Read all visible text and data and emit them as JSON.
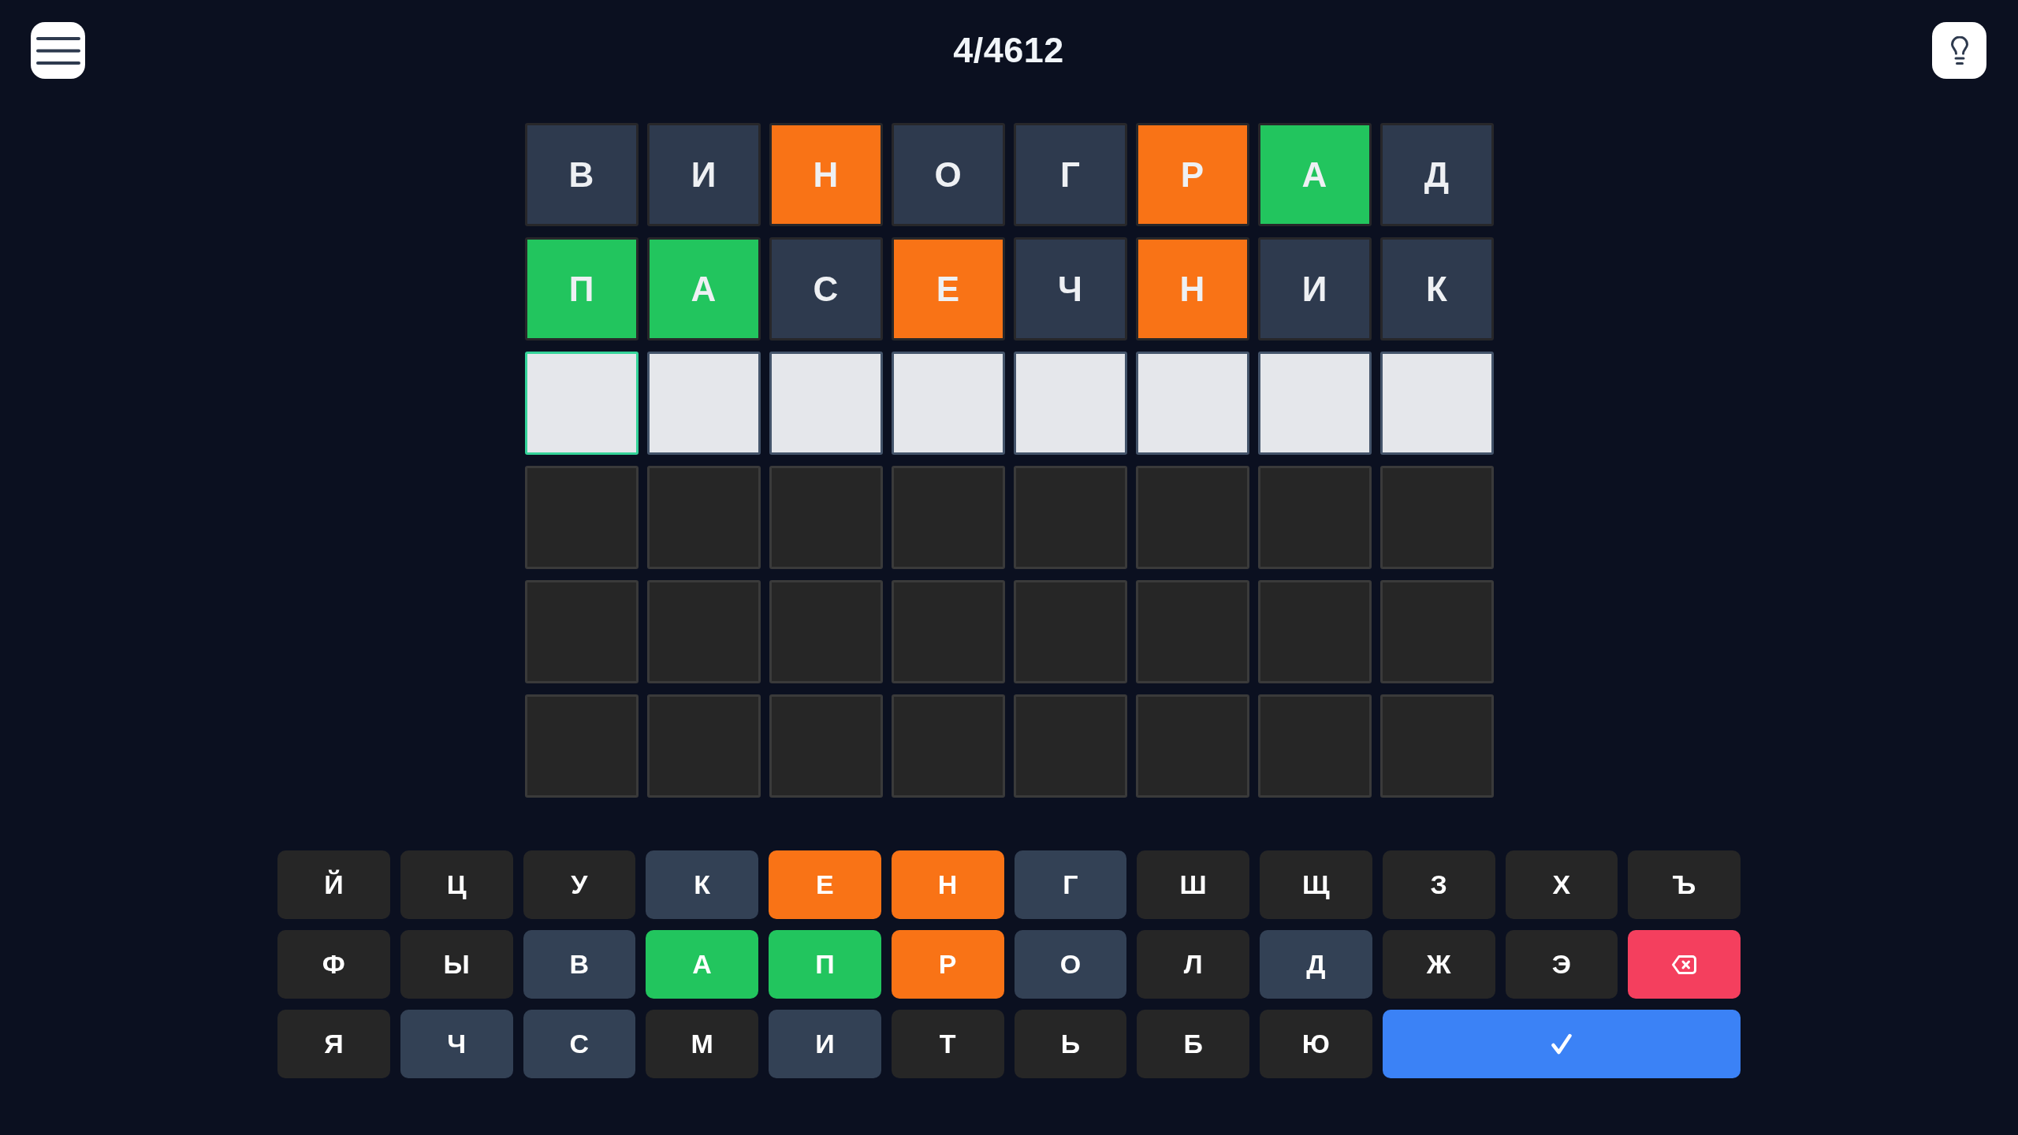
{
  "header": {
    "title": "4/4612"
  },
  "board": {
    "rows": [
      {
        "tiles": [
          {
            "kind": "letter",
            "letter": "В",
            "color": "#2e3a4e"
          },
          {
            "kind": "letter",
            "letter": "И",
            "color": "#2e3a4e"
          },
          {
            "kind": "letter",
            "letter": "Н",
            "color": "#f97316"
          },
          {
            "kind": "letter",
            "letter": "О",
            "color": "#2e3a4e"
          },
          {
            "kind": "letter",
            "letter": "Г",
            "color": "#2e3a4e"
          },
          {
            "kind": "letter",
            "letter": "Р",
            "color": "#f97316"
          },
          {
            "kind": "letter",
            "letter": "А",
            "color": "#22c55e"
          },
          {
            "kind": "letter",
            "letter": "Д",
            "color": "#2e3a4e"
          }
        ]
      },
      {
        "tiles": [
          {
            "kind": "letter",
            "letter": "П",
            "color": "#22c55e"
          },
          {
            "kind": "letter",
            "letter": "А",
            "color": "#22c55e"
          },
          {
            "kind": "letter",
            "letter": "С",
            "color": "#2e3a4e"
          },
          {
            "kind": "letter",
            "letter": "Е",
            "color": "#f97316"
          },
          {
            "kind": "letter",
            "letter": "Ч",
            "color": "#2e3a4e"
          },
          {
            "kind": "letter",
            "letter": "Н",
            "color": "#f97316"
          },
          {
            "kind": "letter",
            "letter": "И",
            "color": "#2e3a4e"
          },
          {
            "kind": "letter",
            "letter": "К",
            "color": "#2e3a4e"
          }
        ]
      },
      {
        "tiles": [
          {
            "kind": "input",
            "selected": true
          },
          {
            "kind": "input",
            "selected": false
          },
          {
            "kind": "input",
            "selected": false
          },
          {
            "kind": "input",
            "selected": false
          },
          {
            "kind": "input",
            "selected": false
          },
          {
            "kind": "input",
            "selected": false
          },
          {
            "kind": "input",
            "selected": false
          },
          {
            "kind": "input",
            "selected": false
          }
        ]
      },
      {
        "tiles": [
          {
            "kind": "empty"
          },
          {
            "kind": "empty"
          },
          {
            "kind": "empty"
          },
          {
            "kind": "empty"
          },
          {
            "kind": "empty"
          },
          {
            "kind": "empty"
          },
          {
            "kind": "empty"
          },
          {
            "kind": "empty"
          }
        ]
      },
      {
        "tiles": [
          {
            "kind": "empty"
          },
          {
            "kind": "empty"
          },
          {
            "kind": "empty"
          },
          {
            "kind": "empty"
          },
          {
            "kind": "empty"
          },
          {
            "kind": "empty"
          },
          {
            "kind": "empty"
          },
          {
            "kind": "empty"
          }
        ]
      },
      {
        "tiles": [
          {
            "kind": "empty"
          },
          {
            "kind": "empty"
          },
          {
            "kind": "empty"
          },
          {
            "kind": "empty"
          },
          {
            "kind": "empty"
          },
          {
            "kind": "empty"
          },
          {
            "kind": "empty"
          },
          {
            "kind": "empty"
          }
        ]
      }
    ]
  },
  "keyboard": {
    "rows": [
      {
        "keys": [
          {
            "kind": "letter",
            "label": "Й",
            "color": "#262626"
          },
          {
            "kind": "letter",
            "label": "Ц",
            "color": "#262626"
          },
          {
            "kind": "letter",
            "label": "У",
            "color": "#262626"
          },
          {
            "kind": "letter",
            "label": "К",
            "color": "#334155"
          },
          {
            "kind": "letter",
            "label": "Е",
            "color": "#f97316"
          },
          {
            "kind": "letter",
            "label": "Н",
            "color": "#f97316"
          },
          {
            "kind": "letter",
            "label": "Г",
            "color": "#334155"
          },
          {
            "kind": "letter",
            "label": "Ш",
            "color": "#262626"
          },
          {
            "kind": "letter",
            "label": "Щ",
            "color": "#262626"
          },
          {
            "kind": "letter",
            "label": "З",
            "color": "#262626"
          },
          {
            "kind": "letter",
            "label": "Х",
            "color": "#262626"
          },
          {
            "kind": "letter",
            "label": "Ъ",
            "color": "#262626"
          }
        ]
      },
      {
        "keys": [
          {
            "kind": "letter",
            "label": "Ф",
            "color": "#262626"
          },
          {
            "kind": "letter",
            "label": "Ы",
            "color": "#262626"
          },
          {
            "kind": "letter",
            "label": "В",
            "color": "#334155"
          },
          {
            "kind": "letter",
            "label": "А",
            "color": "#22c55e"
          },
          {
            "kind": "letter",
            "label": "П",
            "color": "#22c55e"
          },
          {
            "kind": "letter",
            "label": "Р",
            "color": "#f97316"
          },
          {
            "kind": "letter",
            "label": "О",
            "color": "#334155"
          },
          {
            "kind": "letter",
            "label": "Л",
            "color": "#262626"
          },
          {
            "kind": "letter",
            "label": "Д",
            "color": "#334155"
          },
          {
            "kind": "letter",
            "label": "Ж",
            "color": "#262626"
          },
          {
            "kind": "letter",
            "label": "Э",
            "color": "#262626"
          },
          {
            "kind": "backspace"
          }
        ]
      },
      {
        "keys": [
          {
            "kind": "letter",
            "label": "Я",
            "color": "#262626"
          },
          {
            "kind": "letter",
            "label": "Ч",
            "color": "#334155"
          },
          {
            "kind": "letter",
            "label": "С",
            "color": "#334155"
          },
          {
            "kind": "letter",
            "label": "М",
            "color": "#262626"
          },
          {
            "kind": "letter",
            "label": "И",
            "color": "#334155"
          },
          {
            "kind": "letter",
            "label": "Т",
            "color": "#262626"
          },
          {
            "kind": "letter",
            "label": "Ь",
            "color": "#262626"
          },
          {
            "kind": "letter",
            "label": "Б",
            "color": "#262626"
          },
          {
            "kind": "letter",
            "label": "Ю",
            "color": "#262626"
          },
          {
            "kind": "enter"
          }
        ]
      }
    ]
  }
}
